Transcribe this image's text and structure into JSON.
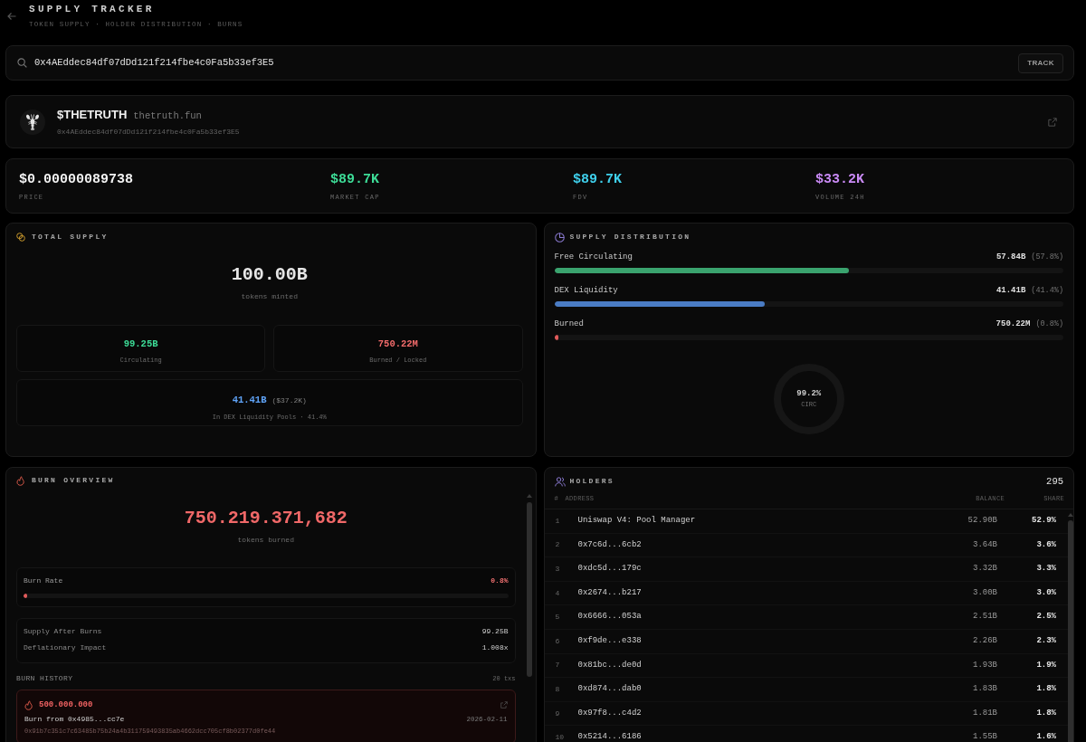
{
  "header": {
    "title": "SUPPLY TRACKER",
    "subtitle": "TOKEN SUPPLY · HOLDER DISTRIBUTION · BURNS"
  },
  "search": {
    "value": "0x4AEddec84df07dDd121f214fbe4c0Fa5b33ef3E5",
    "button": "TRACK"
  },
  "token": {
    "symbol": "$THETRUTH",
    "site": "thetruth.fun",
    "address": "0x4AEddec84df07dDd121f214fbe4c0Fa5b33ef3E5"
  },
  "stats": [
    {
      "value": "$0.00000089738",
      "label": "PRICE",
      "color": "#f2f2f2"
    },
    {
      "value": "$89.7K",
      "label": "MARKET CAP",
      "color": "#3ddc97"
    },
    {
      "value": "$89.7K",
      "label": "FDV",
      "color": "#3fd0ec"
    },
    {
      "value": "$33.2K",
      "label": "VOLUME 24H",
      "color": "#c98af5"
    }
  ],
  "total_supply": {
    "title": "TOTAL SUPPLY",
    "value": "100.00B",
    "caption": "tokens minted",
    "cards": [
      {
        "value": "99.25B",
        "label": "Circulating",
        "color": "#3ddc97"
      },
      {
        "value": "750.22M",
        "label": "Burned / Locked",
        "color": "#f26b6b"
      }
    ],
    "liquidity": {
      "value": "41.41B",
      "usd": "($37.2K)",
      "label": "In DEX Liquidity Pools · 41.4%"
    }
  },
  "supply_distribution": {
    "title": "SUPPLY DISTRIBUTION",
    "rows": [
      {
        "label": "Free Circulating",
        "amount": "57.84B",
        "percent": "(57.8%)",
        "level": 0.578,
        "color": "#3aa36e"
      },
      {
        "label": "DEX Liquidity",
        "amount": "41.41B",
        "percent": "(41.4%)",
        "level": 0.414,
        "color": "#4a7cc4"
      },
      {
        "label": "Burned",
        "amount": "750.22M",
        "percent": "(0.8%)",
        "level": 0.008,
        "color": "#e05a5a"
      }
    ],
    "ring": {
      "value": "99.2%",
      "label": "CIRC"
    }
  },
  "burn_overview": {
    "title": "BURN OVERVIEW",
    "value": "750.219.371,682",
    "caption": "tokens burned",
    "burn_rate": {
      "label": "Burn Rate",
      "value": "0.8%",
      "level": 0.008
    },
    "metrics": [
      {
        "label": "Supply After Burns",
        "value": "99.25B"
      },
      {
        "label": "Deflationary Impact",
        "value": "1.008x"
      }
    ],
    "history": {
      "title": "BURN HISTORY",
      "count": "20 txs",
      "items": [
        {
          "amount": "500.000.000",
          "description": "Burn from 0x4985...cc7e",
          "date": "2026-02-11",
          "hash": "0x91b7c351c7c63485b75b24a4b311759493835ab4662dcc705cf8b02377d0fe44"
        }
      ]
    }
  },
  "holders": {
    "title": "HOLDERS",
    "count": "295",
    "columns": [
      "#",
      "ADDRESS",
      "BALANCE",
      "SHARE"
    ],
    "rows": [
      {
        "rank": "1",
        "address": "Uniswap V4: Pool Manager",
        "balance": "52.90B",
        "share": "52.9%"
      },
      {
        "rank": "2",
        "address": "0x7c6d...6cb2",
        "balance": "3.64B",
        "share": "3.6%"
      },
      {
        "rank": "3",
        "address": "0xdc5d...179c",
        "balance": "3.32B",
        "share": "3.3%"
      },
      {
        "rank": "4",
        "address": "0x2674...b217",
        "balance": "3.00B",
        "share": "3.0%"
      },
      {
        "rank": "5",
        "address": "0x6666...053a",
        "balance": "2.51B",
        "share": "2.5%"
      },
      {
        "rank": "6",
        "address": "0xf9de...e338",
        "balance": "2.26B",
        "share": "2.3%"
      },
      {
        "rank": "7",
        "address": "0x81bc...de0d",
        "balance": "1.93B",
        "share": "1.9%"
      },
      {
        "rank": "8",
        "address": "0xd874...dab0",
        "balance": "1.83B",
        "share": "1.8%"
      },
      {
        "rank": "9",
        "address": "0x97f8...c4d2",
        "balance": "1.81B",
        "share": "1.8%"
      },
      {
        "rank": "10",
        "address": "0x5214...6186",
        "balance": "1.55B",
        "share": "1.6%"
      }
    ]
  }
}
